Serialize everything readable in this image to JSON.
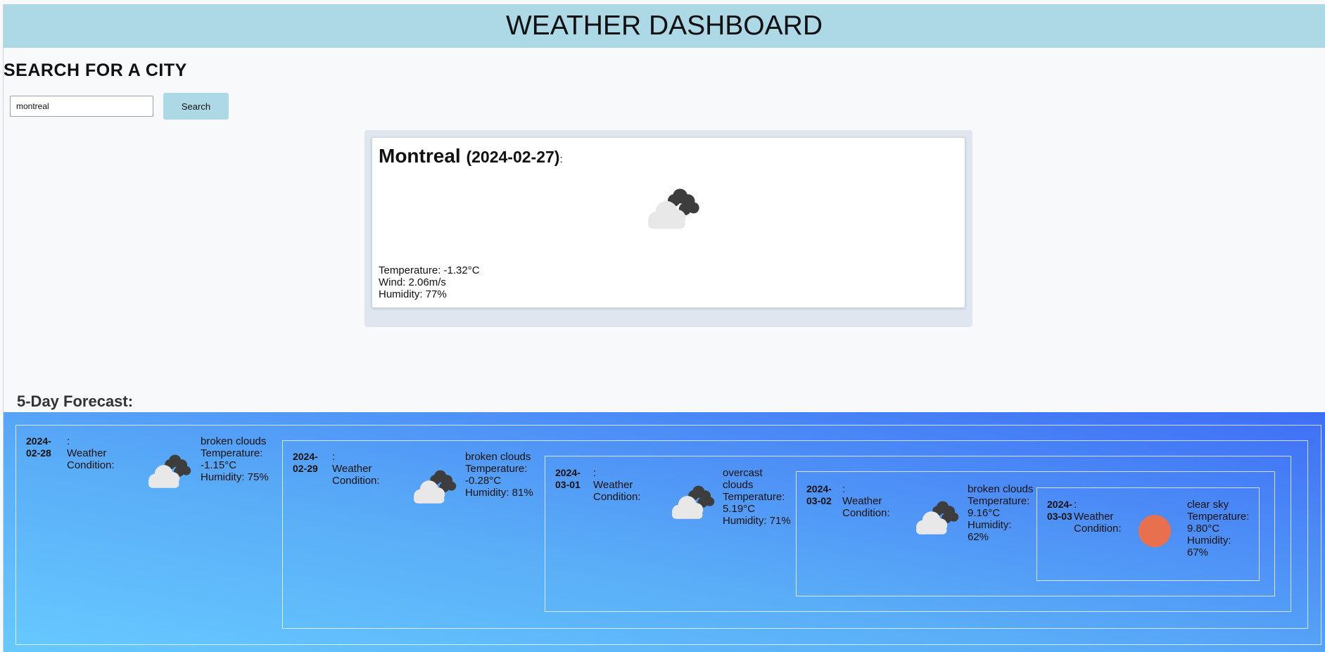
{
  "header": {
    "title": "WEATHER DASHBOARD"
  },
  "search": {
    "heading": "SEARCH FOR A CITY",
    "input_value": "montreal",
    "button_label": "Search"
  },
  "current": {
    "city": "Montreal",
    "date": "(2024-02-27)",
    "colon": ":",
    "icon": "broken-clouds-icon",
    "temperature": "Temperature: -1.32°C",
    "wind": "Wind: 2.06m/s",
    "humidity": "Humidity: 77%"
  },
  "forecast": {
    "heading": "5-Day Forecast:",
    "days": [
      {
        "date_line1": "2024-",
        "date_line2": "02-28",
        "colon": ":",
        "label": "Weather Condition:",
        "icon": "broken-clouds-icon",
        "condition": "broken clouds",
        "temperature": "Temperature: -1.15°C",
        "humidity": "Humidity: 75%"
      },
      {
        "date_line1": "2024-",
        "date_line2": "02-29",
        "colon": ":",
        "label": "Weather Condition:",
        "icon": "broken-clouds-icon",
        "condition": "broken clouds",
        "temperature": "Temperature: -0.28°C",
        "humidity": "Humidity: 81%"
      },
      {
        "date_line1": "2024-",
        "date_line2": "03-01",
        "colon": ":",
        "label": "Weather Condition:",
        "icon": "broken-clouds-icon",
        "condition": "overcast clouds",
        "temperature": "Temperature: 5.19°C",
        "humidity": "Humidity: 71%"
      },
      {
        "date_line1": "2024-",
        "date_line2": "03-02",
        "colon": ":",
        "label": "Weather Condition:",
        "icon": "broken-clouds-icon",
        "condition": "broken clouds",
        "temperature": "Temperature: 9.16°C",
        "humidity": "Humidity: 62%"
      },
      {
        "date_line1": "2024-",
        "date_line2": "03-03",
        "colon": ":",
        "label": "Weather Condition:",
        "icon": "clear-sky-icon",
        "condition": "clear sky",
        "temperature": "Temperature: 9.80°C",
        "humidity": "Humidity: 67%"
      }
    ]
  },
  "colors": {
    "header_bg": "#add8e6",
    "button_bg": "#add8e6",
    "forecast_gradient_start": "#67c9ff",
    "forecast_gradient_end": "#3f6ef6",
    "sun": "#e8704e"
  }
}
